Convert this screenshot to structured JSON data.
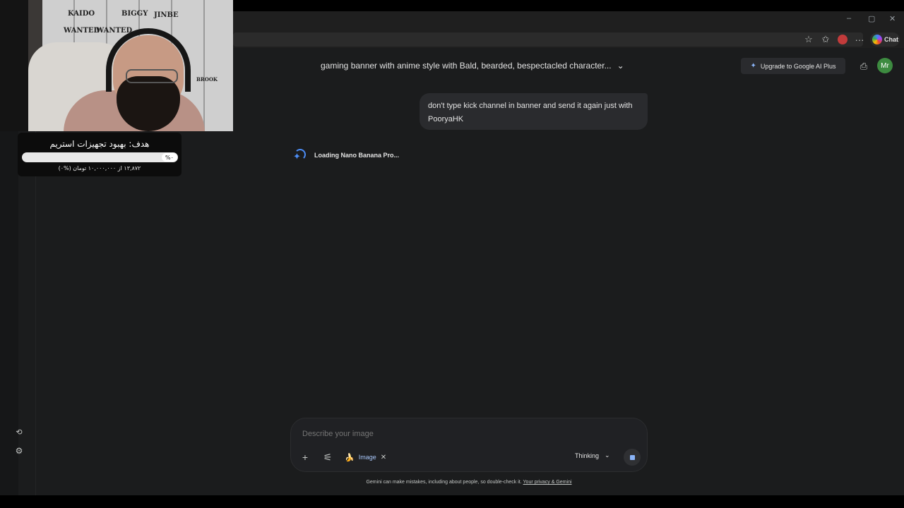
{
  "browser": {
    "window_controls": [
      "–",
      "▢",
      "✕"
    ],
    "chat_label": "Chat"
  },
  "gemini": {
    "conversation_title": "gaming banner with anime style with Bald, bearded, bespectacled character...",
    "upgrade_label": "Upgrade to Google AI Plus",
    "avatar_initials": "Mr",
    "user_message": "don't type kick channel in banner and send it again just with PooryaHK",
    "loading_text": "Loading Nano Banana Pro...",
    "composer": {
      "placeholder": "Describe your image",
      "image_chip_label": "Image",
      "mode_label": "Thinking"
    },
    "disclaimer_text": "Gemini can make mistakes, including about people, so double-check it.",
    "disclaimer_link": "Your privacy & Gemini"
  },
  "stream_overlay": {
    "poster_labels": [
      "KAIDO",
      "BIGGY",
      "JINBE",
      "WANTED",
      "WANTED",
      "BROOK"
    ],
    "goal_title": "هدف: بهبود تجهیزات استریم",
    "goal_percent_label": "%۰",
    "goal_progress_fraction": 0.0,
    "goal_subtitle": "۱۳,۸۷۲ از ۱۰,۰۰۰,۰۰۰ تومان (%۰)"
  },
  "colors": {
    "page_bg": "#1b1c1d",
    "accent_blue": "#4c8df6",
    "avatar_green": "#3d8b40"
  }
}
